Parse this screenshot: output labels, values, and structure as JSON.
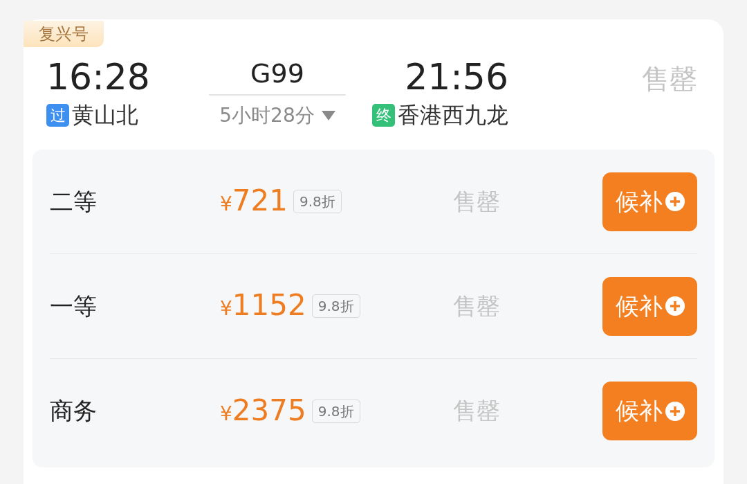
{
  "train_type": "复兴号",
  "departure": {
    "time": "16:28",
    "station_tag": "过",
    "color": "#3d8ff0",
    "station": "黄山北"
  },
  "train_number": "G99",
  "duration": "5小时28分",
  "arrival": {
    "time": "21:56",
    "station_tag": "终",
    "color": "#35c07a",
    "station": "香港西九龙"
  },
  "status": "售罄",
  "seats": [
    {
      "class": "二等",
      "currency": "¥",
      "price": "721",
      "discount": "9.8折",
      "status": "售罄",
      "button": "候补"
    },
    {
      "class": "一等",
      "currency": "¥",
      "price": "1152",
      "discount": "9.8折",
      "status": "售罄",
      "button": "候补"
    },
    {
      "class": "商务",
      "currency": "¥",
      "price": "2375",
      "discount": "9.8折",
      "status": "售罄",
      "button": "候补"
    }
  ]
}
